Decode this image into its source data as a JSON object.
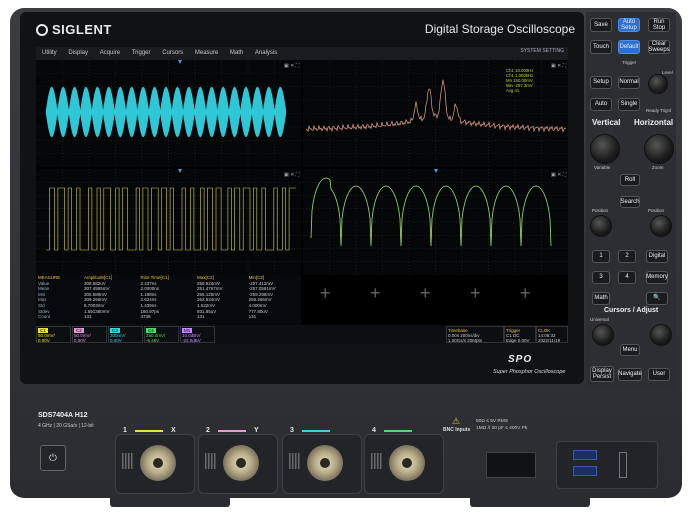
{
  "brand": {
    "name": "SIGLENT",
    "title": "Digital Storage Oscilloscope"
  },
  "menu": [
    "Utility",
    "Display",
    "Acquire",
    "Trigger",
    "Cursors",
    "Measure",
    "Math",
    "Analysis"
  ],
  "menu_status": "SYSTEM SETTING",
  "fft_readout": [
    "Ch1  10.000Hz",
    "Ch1  1.000kHz",
    "Mn  150.00mV",
    "Min  -297.3mV",
    "Avg  41"
  ],
  "measure_table": {
    "headers": [
      "MEASURE",
      "Amplitude[C1]",
      "Rise Time[C1]",
      "Max[C2]",
      "Min[C2]"
    ],
    "rows": [
      [
        "Value",
        "308.582uV",
        "2.437ns",
        "259.924mV",
        "-257.412mV"
      ],
      [
        "Mean",
        "307.4995mV",
        "2.0000ns",
        "251.4767mV",
        "-257.0581mV"
      ],
      [
        "Min",
        "305.589mV",
        "1.188ns",
        "255.125mV",
        "-259.296mV"
      ],
      [
        "Max",
        "309.260mV",
        "2.624ns",
        "262.534mV",
        "255.266mV"
      ],
      [
        "Std",
        "8.7003mV",
        "1.439ns",
        "1.532mV",
        "4.000mV"
      ],
      [
        "Stdev",
        "1.591380mV",
        "160.97ps",
        "931.85uV",
        "777.80uV"
      ],
      [
        "Count",
        "131",
        "4738",
        "131",
        "131"
      ]
    ]
  },
  "channels": [
    {
      "id": "C1",
      "color": "#e8e33a",
      "lines": [
        "50.0mV/",
        "0.00V"
      ]
    },
    {
      "id": "C2",
      "color": "#e39bd8",
      "lines": [
        "50.0mV/",
        "0.00V"
      ]
    },
    {
      "id": "C3",
      "color": "#3fd3e8",
      "lines": [
        "200mV/",
        "0.00V"
      ]
    },
    {
      "id": "C4",
      "color": "#5bd66a",
      "lines": [
        "250.0mV/",
        "-5.48V"
      ]
    },
    {
      "id": "M1",
      "color": "#c68cff",
      "lines": [
        "10.0dBV/",
        "-22.0dBV"
      ]
    }
  ],
  "timebase": {
    "label": "Timebase",
    "values": [
      "0.00s",
      "200ns/div",
      "1.00Gs/s",
      "20Mpts"
    ]
  },
  "trigger": {
    "label": "Trigger",
    "values": [
      "C1 DC",
      "Edge",
      "0.00V"
    ]
  },
  "clock": {
    "label": "CLOK",
    "values": [
      "14:06:32",
      "2022/11/19"
    ]
  },
  "spo": {
    "logo": "SPO",
    "subtitle": "Super Phosphor Oscilloscope"
  },
  "front_panel": {
    "model": "SDS7404A  H12",
    "spec": "4 GHz | 20 GSa/s | 12-bit",
    "bnc_inputs_label": "BNC Inputs",
    "bnc_spec": [
      "50Ω ≤ 5V RMS",
      "1MΩ // 20 pF ≤ 400V Pk"
    ]
  },
  "inputs": [
    {
      "num": "1",
      "axis": "X",
      "color": "#e8e33a"
    },
    {
      "num": "2",
      "axis": "Y",
      "color": "#e39bd8"
    },
    {
      "num": "3",
      "axis": "",
      "color": "#3fd3e8"
    },
    {
      "num": "4",
      "axis": "",
      "color": "#5bd66a"
    }
  ],
  "buttons": {
    "save": "Save",
    "auto_setup": "Auto Setup",
    "run_stop": "Run Stop",
    "touch": "Touch",
    "default": "Default",
    "clear_sweeps": "Clear Sweeps",
    "setup": "Setup",
    "normal": "Normal",
    "auto": "Auto",
    "single": "Single",
    "roll": "Roll",
    "search": "Search",
    "math": "Math",
    "digital": "Digital",
    "memory": "Memory",
    "display_persist": "Display Persist",
    "navigate": "Navigate",
    "user": "User",
    "menu": "Menu",
    "ch1": "1",
    "ch2": "2",
    "ch3": "3",
    "ch4": "4"
  },
  "labels": {
    "trigger": "Trigger",
    "vertical": "Vertical",
    "horizontal": "Horizontal",
    "cursors_adjust": "Cursors / Adjust",
    "position": "Position",
    "variable": "Variable",
    "zoom": "Zoom",
    "universal": "Universal",
    "ready": "Ready",
    "trigd": "Trig'd",
    "level": "Level"
  }
}
